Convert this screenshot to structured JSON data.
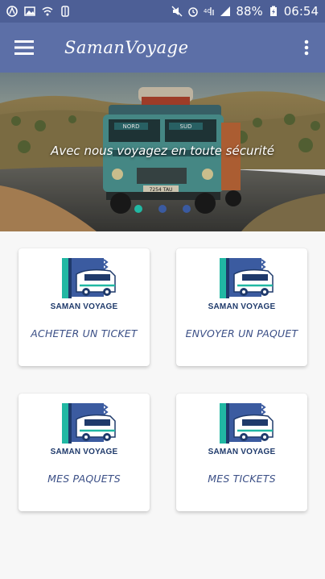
{
  "status_bar": {
    "battery": "88%",
    "time": "06:54"
  },
  "app_bar": {
    "title": "SamanVoyage"
  },
  "banner": {
    "caption": "Avec nous voyagez en toute sécurité",
    "bus_signs": [
      "NORD",
      "SUD"
    ],
    "bus_plate": "7254 TAU"
  },
  "cards": [
    {
      "brand": "SAMAN VOYAGE",
      "label": "ACHETER UN TICKET"
    },
    {
      "brand": "SAMAN VOYAGE",
      "label": "ENVOYER UN PAQUET"
    },
    {
      "brand": "SAMAN VOYAGE",
      "label": "MES PAQUETS"
    },
    {
      "brand": "SAMAN VOYAGE",
      "label": "MES TICKETS"
    }
  ],
  "colors": {
    "status_bar": "#4d5f96",
    "app_bar": "#5c6fa7",
    "accent_teal": "#21b8a3",
    "dot_blue": "#3a5aa0",
    "label_text": "#3b4f86"
  }
}
